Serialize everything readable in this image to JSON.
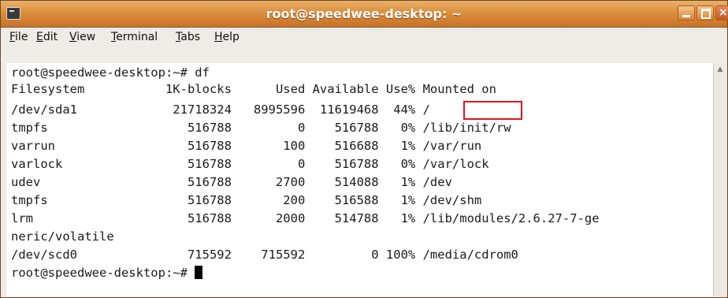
{
  "window": {
    "title": "root@speedwee-desktop: ~",
    "buttons": {
      "minimize": "minimize-icon",
      "maximize": "maximize-icon",
      "close": "close-icon"
    }
  },
  "menubar": {
    "items": [
      {
        "key": "F",
        "rest": "ile"
      },
      {
        "key": "E",
        "rest": "dit"
      },
      {
        "key": "V",
        "rest": "iew"
      },
      {
        "key": "T",
        "rest": "erminal"
      },
      {
        "key": "T",
        "rest": "abs"
      },
      {
        "key": "H",
        "rest": "elp"
      }
    ]
  },
  "terminal": {
    "lines": [
      "root@speedwee-desktop:~# df",
      "Filesystem           1K-blocks      Used Available Use% Mounted on",
      "/dev/sda1             21718324   8995596  11619468  44% /",
      "tmpfs                   516788         0    516788   0% /lib/init/rw",
      "varrun                  516788       100    516688   1% /var/run",
      "varlock                 516788         0    516788   0% /var/lock",
      "udev                    516788      2700    514088   1% /dev",
      "tmpfs                   516788       200    516588   1% /dev/shm",
      "lrm                     516788      2000    514788   1% /lib/modules/2.6.27-7-ge",
      "neric/volatile",
      "/dev/scd0               715592    715592         0 100% /media/cdrom0"
    ],
    "prompt": "root@speedwee-desktop:~# "
  },
  "colors": {
    "titlebar": "#dc8f3c",
    "highlight": "#e0161c",
    "terminal_bg": "#ffffff",
    "terminal_fg": "#1a1a1a"
  }
}
